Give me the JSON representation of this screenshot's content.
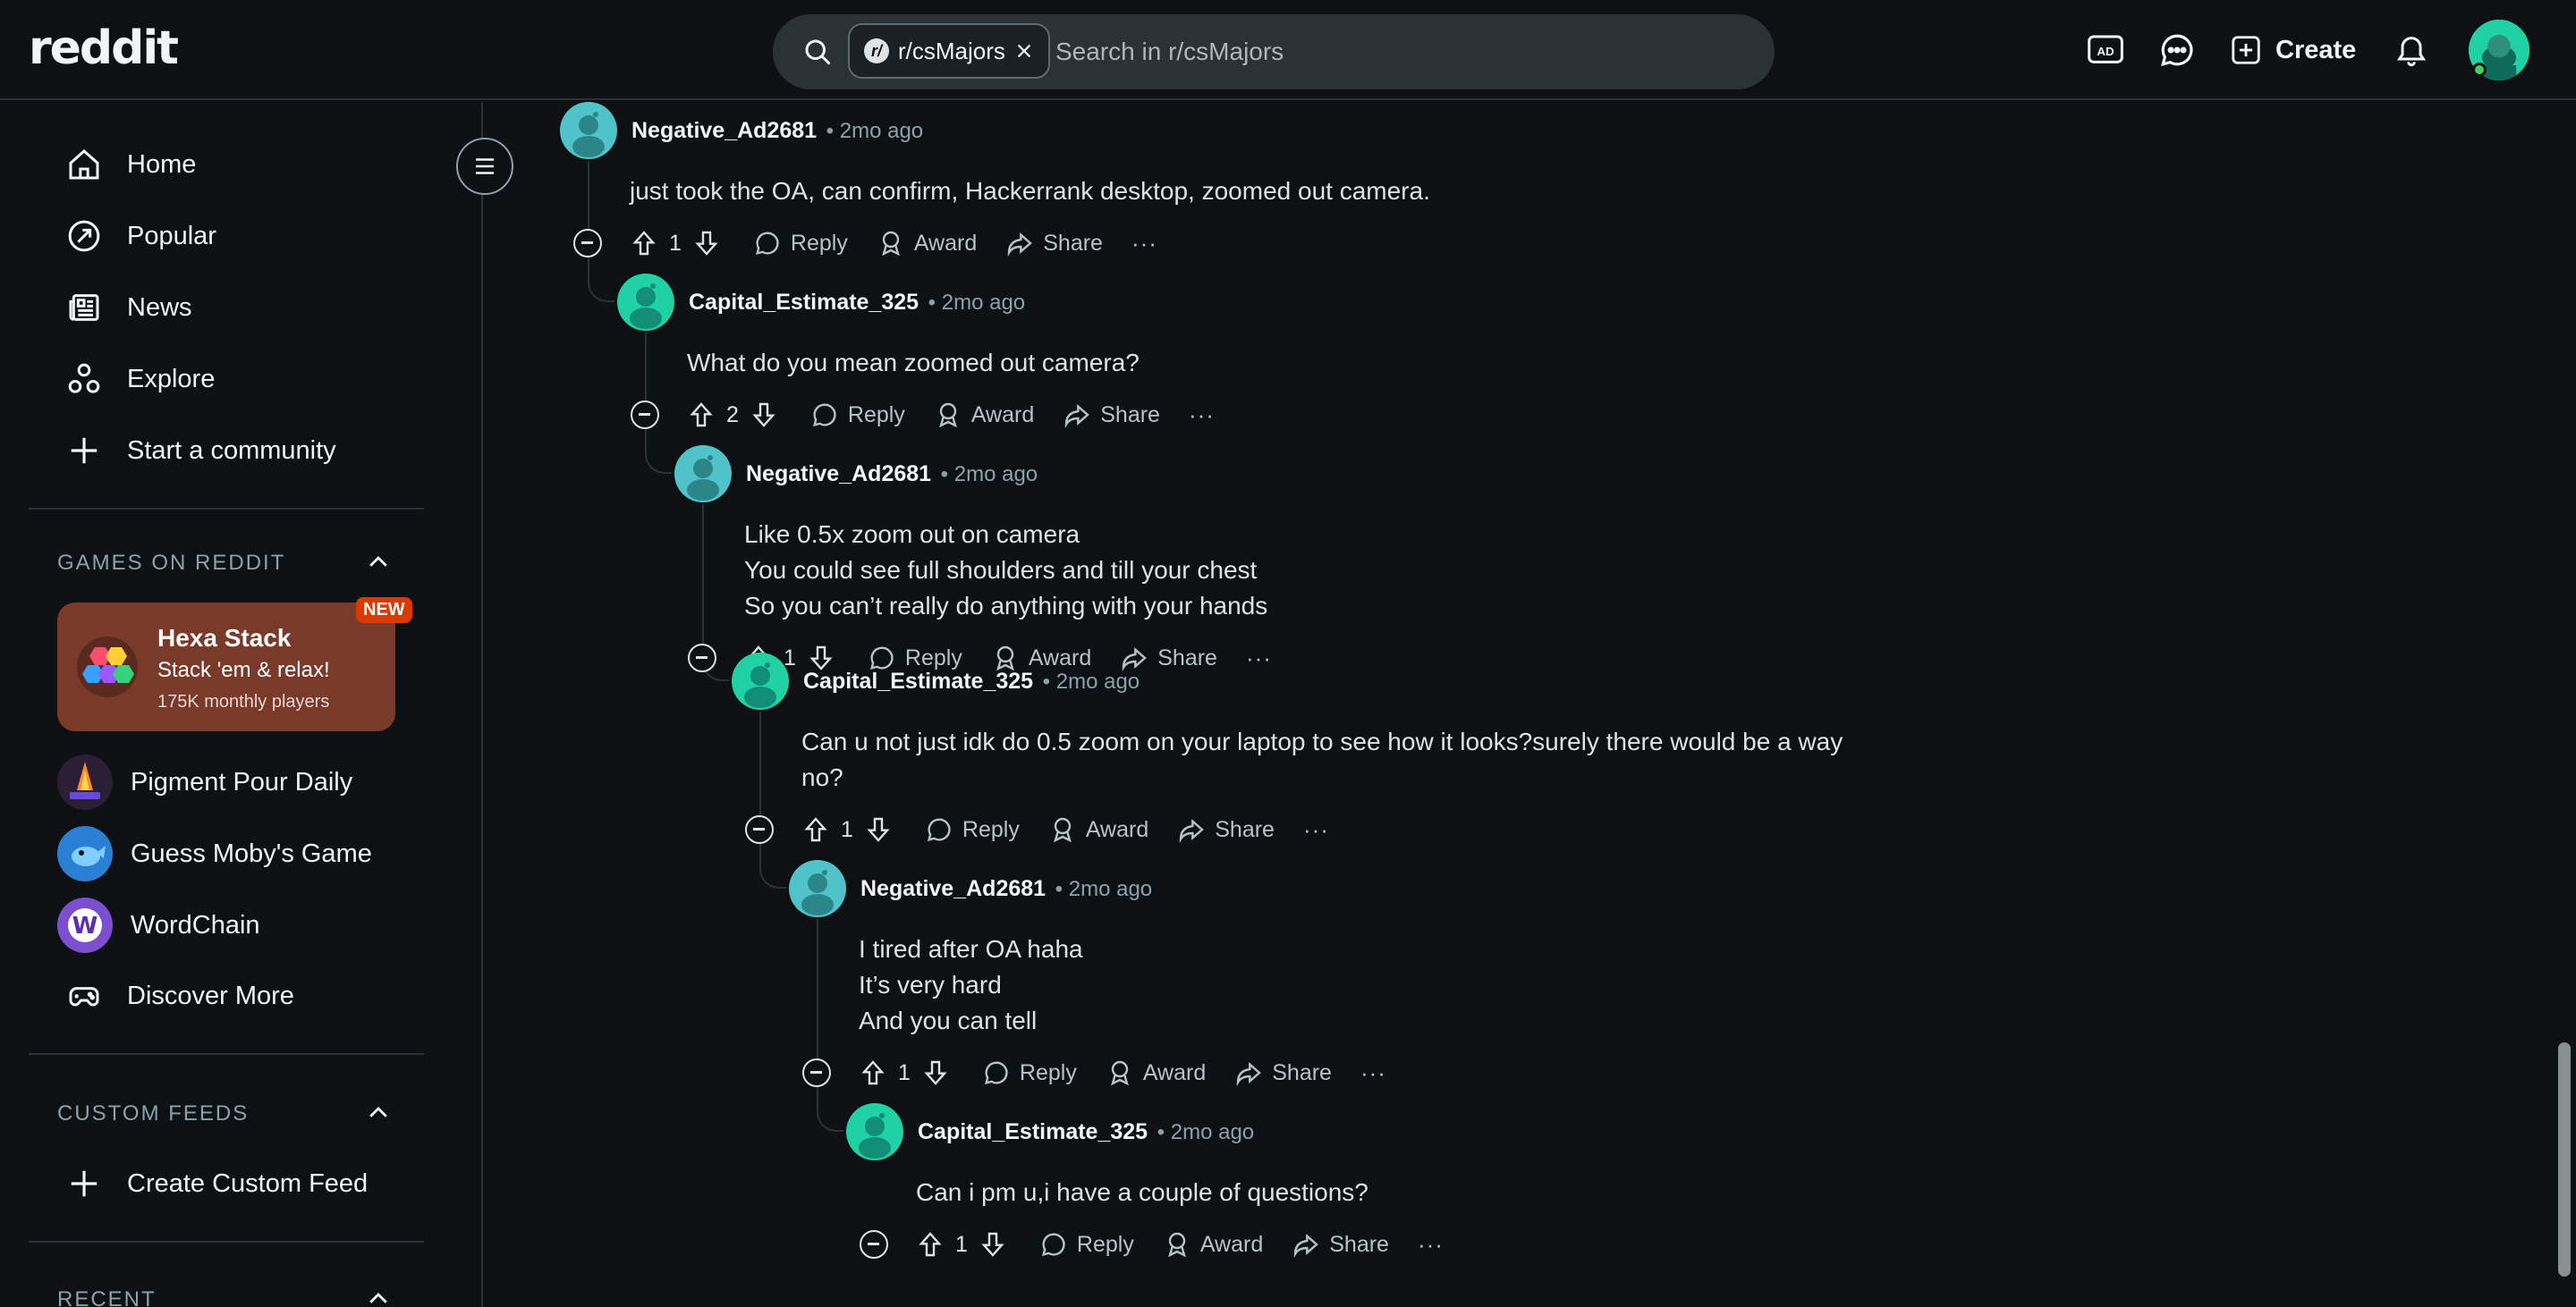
{
  "header": {
    "logo": "reddit",
    "search_chip": "r/csMajors",
    "search_placeholder": "Search in r/csMajors",
    "create_label": "Create"
  },
  "sidebar": {
    "nav": [
      {
        "label": "Home",
        "icon": "home-icon"
      },
      {
        "label": "Popular",
        "icon": "popular-icon"
      },
      {
        "label": "News",
        "icon": "news-icon"
      },
      {
        "label": "Explore",
        "icon": "explore-icon"
      },
      {
        "label": "Start a community",
        "icon": "plus-icon"
      }
    ],
    "games_header": "GAMES ON REDDIT",
    "featured_game": {
      "title": "Hexa Stack",
      "subtitle": "Stack 'em & relax!",
      "players": "175K monthly players",
      "badge": "NEW"
    },
    "games": [
      {
        "label": "Pigment Pour Daily",
        "color": "#3a2a4a"
      },
      {
        "label": "Guess Moby's Game",
        "color": "#2a7fd4"
      },
      {
        "label": "WordChain",
        "color": "#7b4fd0"
      }
    ],
    "discover_more": "Discover More",
    "custom_feeds_header": "CUSTOM FEEDS",
    "create_custom_feed": "Create Custom Feed",
    "recent_header": "RECENT"
  },
  "comments": [
    {
      "author": "Negative_Ad2681",
      "time": "2mo ago",
      "body": "just took the OA, can confirm, Hackerrank desktop, zoomed out camera.",
      "votes": "1",
      "avatar_color": "#4fc3c9"
    },
    {
      "author": "Capital_Estimate_325",
      "time": "2mo ago",
      "body": "What do you mean zoomed out camera?",
      "votes": "2",
      "avatar_color": "#1fd1a5"
    },
    {
      "author": "Negative_Ad2681",
      "time": "2mo ago",
      "body": "Like 0.5x zoom out on camera\nYou could see full shoulders and till your chest\nSo you can’t really do anything with your hands",
      "votes": "1",
      "avatar_color": "#4fc3c9"
    },
    {
      "author": "Capital_Estimate_325",
      "time": "2mo ago",
      "body": "Can u not just idk do 0.5 zoom on your laptop to see how it looks?surely there would be a way\nno?",
      "votes": "1",
      "avatar_color": "#1fd1a5"
    },
    {
      "author": "Negative_Ad2681",
      "time": "2mo ago",
      "body": "I tired after OA haha\nIt’s very hard\nAnd you can tell",
      "votes": "1",
      "avatar_color": "#4fc3c9"
    },
    {
      "author": "Capital_Estimate_325",
      "time": "2mo ago",
      "body": "Can i pm u,i have a couple of questions?",
      "votes": "1",
      "avatar_color": "#1fd1a5"
    }
  ],
  "actions": {
    "reply": "Reply",
    "award": "Award",
    "share": "Share",
    "more": "···"
  }
}
